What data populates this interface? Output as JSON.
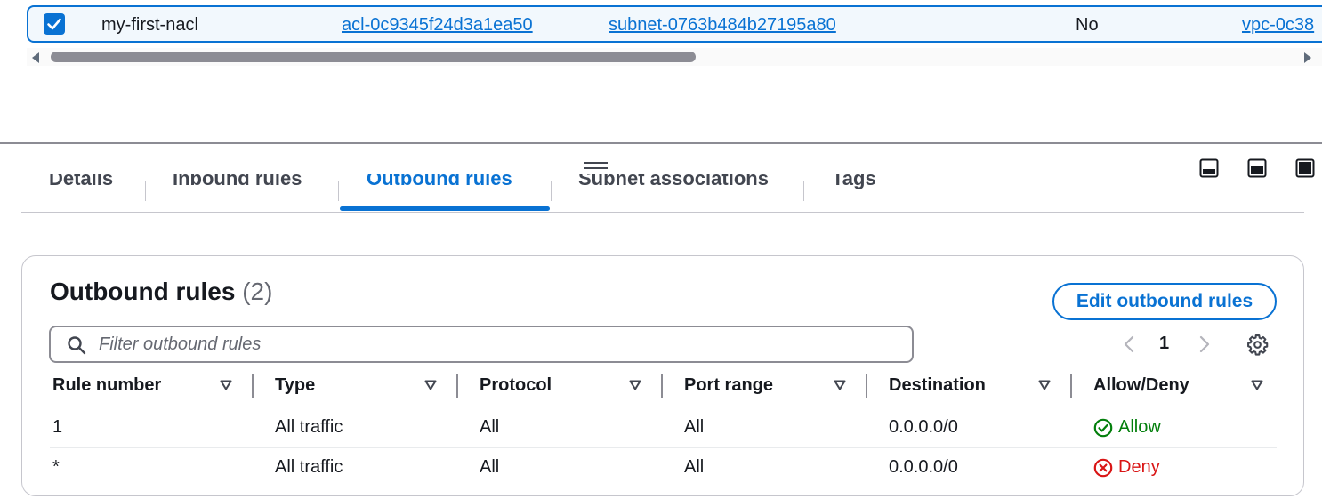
{
  "selected_row": {
    "name": "my-first-nacl",
    "acl_id": "acl-0c9345f24d3a1ea50",
    "subnet_id": "subnet-0763b484b27195a80",
    "default": "No",
    "vpc_id": "vpc-0c38"
  },
  "tabs": [
    {
      "label": "Details"
    },
    {
      "label": "Inbound rules"
    },
    {
      "label": "Outbound rules"
    },
    {
      "label": "Subnet associations"
    },
    {
      "label": "Tags"
    }
  ],
  "active_tab": "Outbound rules",
  "container": {
    "title": "Outbound rules",
    "count": "(2)",
    "edit_button": "Edit outbound rules"
  },
  "filter": {
    "placeholder": "Filter outbound rules",
    "value": ""
  },
  "pagination": {
    "current_page": "1"
  },
  "table": {
    "columns": [
      "Rule number",
      "Type",
      "Protocol",
      "Port range",
      "Destination",
      "Allow/Deny"
    ],
    "rows": [
      {
        "rule_number": "1",
        "type": "All traffic",
        "protocol": "All",
        "port_range": "All",
        "destination": "0.0.0.0/0",
        "action": "Allow",
        "action_icon": "check-circle-icon"
      },
      {
        "rule_number": "*",
        "type": "All traffic",
        "protocol": "All",
        "port_range": "All",
        "destination": "0.0.0.0/0",
        "action": "Deny",
        "action_icon": "x-circle-icon"
      }
    ]
  },
  "colors": {
    "accent": "#0972d3",
    "allow": "#037f0c",
    "deny": "#d91515"
  }
}
